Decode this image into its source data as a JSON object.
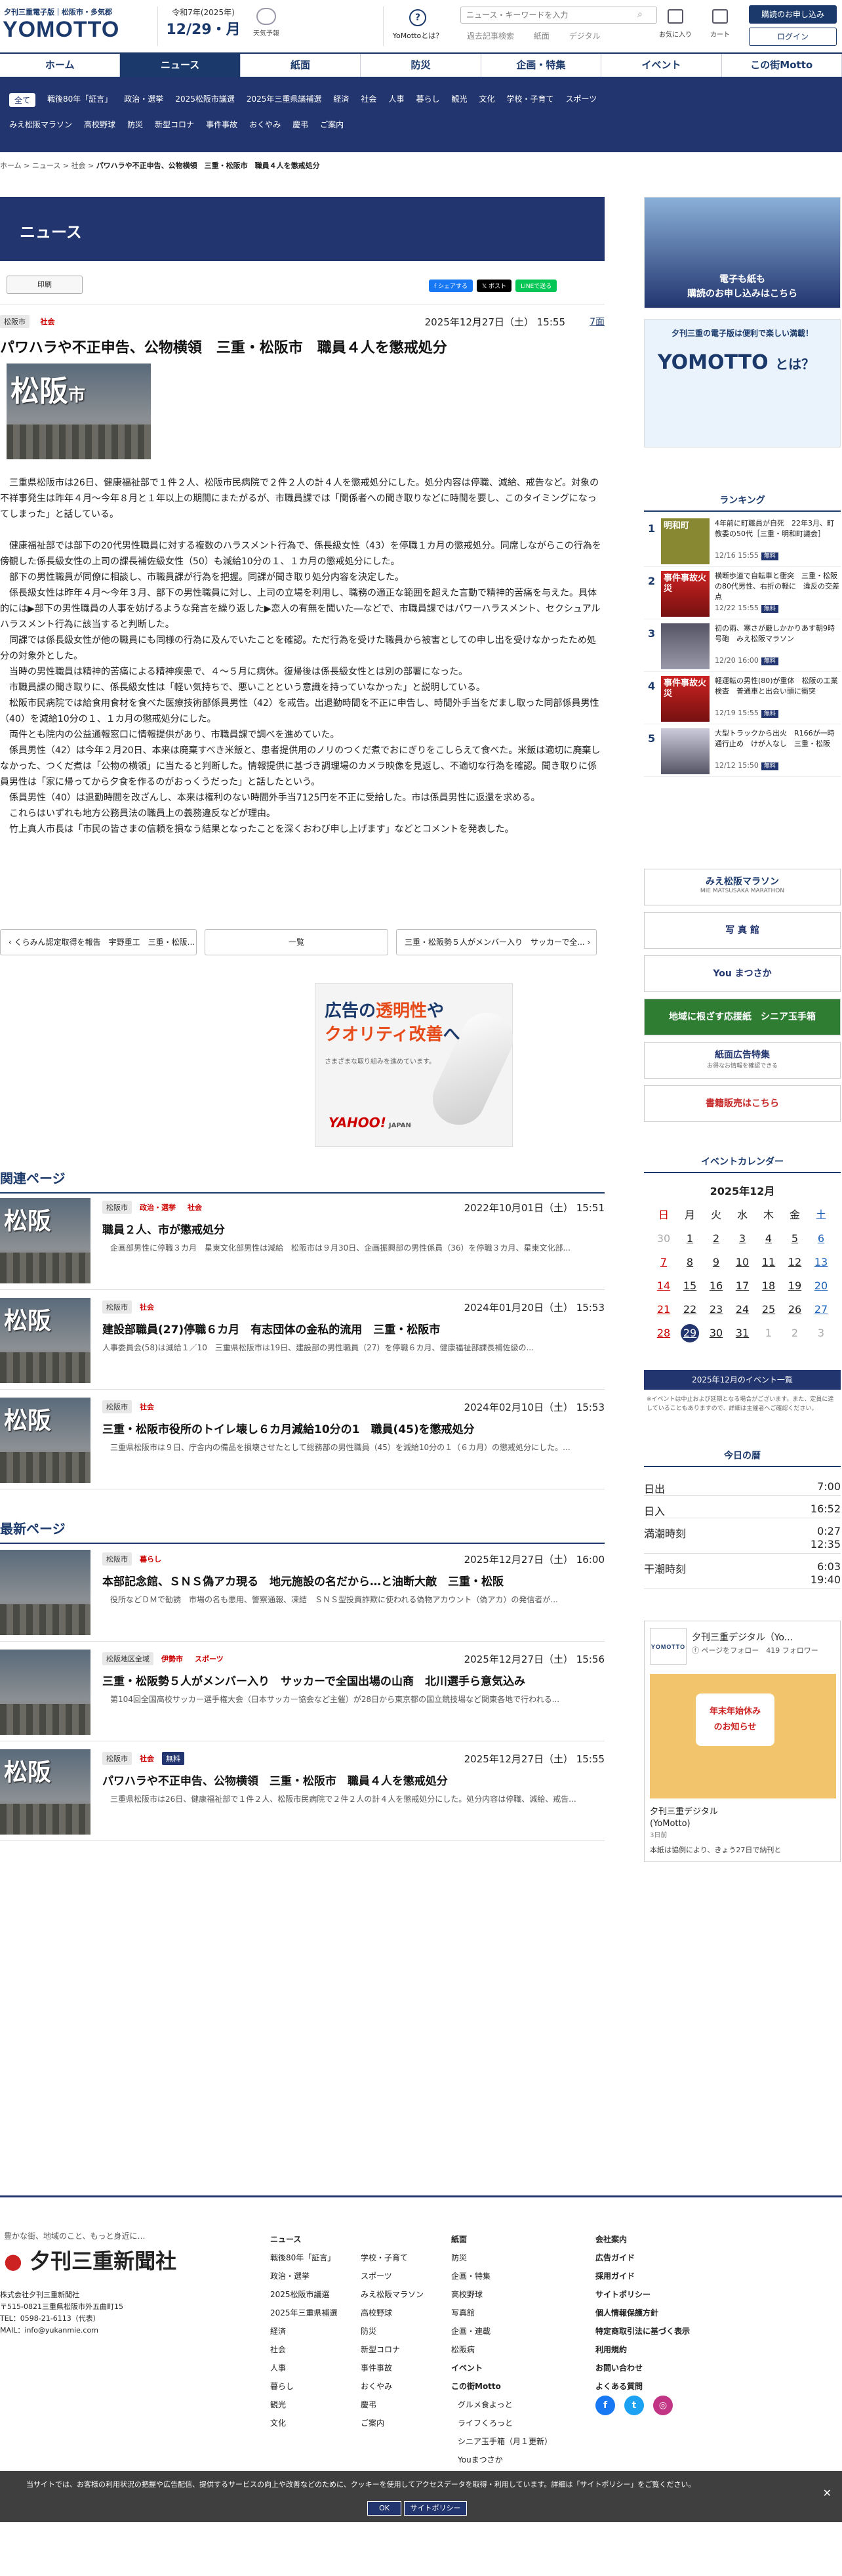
{
  "header": {
    "logo_sub": "夕刊三重電子版｜松阪市・多気郡",
    "logo_text": "YOMOTTO",
    "date_small": "令和7年(2025年)",
    "date_large": "12/29・月",
    "weather_label": "天気予報",
    "whats_label": "YoMottoとは？",
    "search_placeholder": "ニュース・キーワードを入力",
    "links": [
      "過去記事検索",
      "紙面",
      "デジタル"
    ],
    "icons": [
      {
        "label": "お気に入り",
        "icon": "star-icon"
      },
      {
        "label": "カート",
        "icon": "cart-icon"
      }
    ],
    "subscribe_label": "購読のお申し込み",
    "login_label": "ログイン"
  },
  "nav": [
    "ホーム",
    "ニュース",
    "紙面",
    "防災",
    "企画・特集",
    "イベント",
    "この街Motto"
  ],
  "nav_active": 1,
  "subnav": [
    [
      "全て",
      "戦後80年「証言」",
      "政治・選挙",
      "2025松阪市議選",
      "2025年三重県議補選",
      "経済",
      "社会",
      "人事",
      "暮らし",
      "観光",
      "文化",
      "学校・子育て",
      "スポーツ"
    ],
    [
      "みえ松阪マラソン",
      "高校野球",
      "防災",
      "新型コロナ",
      "事件事故",
      "おくやみ",
      "慶弔",
      "ご案内"
    ]
  ],
  "breadcrumb": [
    "ホーム",
    "ニュース",
    "社会",
    "パワハラや不正申告、公物横領　三重・松阪市　職員４人を懲戒処分"
  ],
  "section_title": "ニュース",
  "print_label": "印刷",
  "shares": [
    {
      "label": "f シェアする",
      "color": "#1877f2"
    },
    {
      "label": "𝕏 ポスト",
      "color": "#000000"
    },
    {
      "label": "LINEで送る",
      "color": "#06c755"
    }
  ],
  "article": {
    "tags": [
      "松阪市",
      "社会"
    ],
    "date": "2025年12月27日（土） 15:55",
    "page": "7面",
    "title": "パワハラや不正申告、公物横領　三重・松阪市　職員４人を懲戒処分",
    "thumb_label": "松阪",
    "thumb_label_small": "市",
    "paragraphs": [
      "　三重県松阪市は26日、健康福祉部で１件２人、松阪市民病院で２件２人の計４人を懲戒処分にした。処分内容は停職、減給、戒告など。対象の不祥事発生は昨年４月〜今年８月と１年以上の期間にまたがるが、市職員課では「関係者への聞き取りなどに時間を要し、このタイミングになってしまった」と話している。",
      "　健康福祉部では部下の20代男性職員に対する複数のハラスメント行為で、係長級女性（43）を停職１カ月の懲戒処分。同席しながらこの行為を傍観した係長級女性の上司の課長補佐級女性（50）も減給10分の１、１カ月の懲戒処分にした。",
      "　部下の男性職員が同僚に相談し、市職員課が行為を把握。同課が聞き取り処分内容を決定した。",
      "　係長級女性は昨年４月〜今年３月、部下の男性職員に対し、上司の立場を利用し、職務の適正な範囲を超えた言動で精神的苦痛を与えた。具体的には▶部下の男性職員の人事を妨げるような発言を繰り返した▶恋人の有無を聞いた―などで、市職員課ではパワーハラスメント、セクシュアルハラスメント行為に該当すると判断した。",
      "　同課では係長級女性が他の職員にも同様の行為に及んでいたことを確認。ただ行為を受けた職員から被害としての申し出を受けなかったため処分の対象外とした。",
      "　当時の男性職員は精神的苦痛による精神疾患で、４〜５月に病休。復帰後は係長級女性とは別の部署になった。",
      "　市職員課の聞き取りに、係長級女性は「軽い気持ちで、悪いことという意識を持っていなかった」と説明している。",
      "　松阪市民病院では給食用食材を食べた医療技術部係員男性（42）を戒告。出退勤時間を不正に申告し、時間外手当をだまし取った同部係員男性（40）を減給10分の１、１カ月の懲戒処分にした。",
      "　両件とも院内の公益通報窓口に情報提供があり、市職員課で調べを進めていた。",
      "　係員男性（42）は今年２月20日、本来は廃棄すべき米飯と、患者提供用のノリのつくだ煮でおにぎりをこしらえて食べた。米飯は適切に廃棄しなかった、つくだ煮は「公物の横領」に当たると判断した。情報提供に基づき調理場のカメラ映像を見返し、不適切な行為を確認。聞き取りに係員男性は「家に帰ってから夕食を作るのがおっくうだった」と話したという。",
      "　係員男性（40）は退勤時間を改ざんし、本来は権利のない時間外手当7125円を不正に受給した。市は係員男性に返還を求める。",
      "　これらはいずれも地方公務員法の職員上の義務違反などが理由。",
      "　竹上真人市長は「市民の皆さまの信頼を損なう結果となったことを深くおわび申し上げます」などとコメントを発表した。"
    ]
  },
  "pager": {
    "prev": "くらみん認定取得を報告　宇野重工　三重・松阪...",
    "list": "一覧",
    "next": "三重・松阪勢５人がメンバー入り　サッカーで全..."
  },
  "ad": {
    "line1": "広告の",
    "line1_hl": "透明性",
    "line1b": "や",
    "line2_hl": "クオリティ改善",
    "line2": "へ",
    "sub": "さまざまな取り組みを進めています。",
    "brand": "YAHOO!",
    "brand_sub": "JAPAN"
  },
  "related_heading": "関連ページ",
  "related": [
    {
      "tags": [
        "松阪市",
        "政治・選挙",
        "社会"
      ],
      "date": "2022年10月01日（土） 15:51",
      "title": "職員２人、市が懲戒処分",
      "desc": "　企画部男性に停職３カ月　星東文化部男性は減給　松阪市は９月30日、企画振興部の男性係員（36）を停職３カ月、星東文化部...",
      "thumb": "松阪"
    },
    {
      "tags": [
        "松阪市",
        "社会"
      ],
      "date": "2024年01月20日（土） 15:53",
      "title": "建設部職員(27)停職６カ月　有志団体の金私的流用　三重・松阪市",
      "desc": "人事委員会(58)は減給１／10　三重県松阪市は19日、建設部の男性職員（27）を停職６カ月、健康福祉部課長補佐級の...",
      "thumb": "松阪"
    },
    {
      "tags": [
        "松阪市",
        "社会"
      ],
      "date": "2024年02月10日（土） 15:53",
      "title": "三重・松阪市役所のトイレ壊し６カ月減給10分の1　職員(45)を懲戒処分",
      "desc": "　三重県松阪市は９日、庁舎内の備品を損壊させたとして総務部の男性職員（45）を減給10分の１（６カ月）の懲戒処分にした。...",
      "thumb": "松阪"
    }
  ],
  "latest_heading": "最新ページ",
  "latest": [
    {
      "tags": [
        "松阪市",
        "暮らし"
      ],
      "date": "2025年12月27日（土） 16:00",
      "title": "本部記念館、ＳＮＳ偽アカ現る　地元施設の名だから…と油断大敵　三重・松阪",
      "desc": "　役所などＤＭで勧誘　市場の名も悪用、警察通報、凍結　ＳＮＳ型投資詐欺に使われる偽物アカウント（偽アカ）の発信者が...",
      "thumb": ""
    },
    {
      "tags": [
        "松阪地区全域",
        "伊勢市",
        "スポーツ"
      ],
      "date": "2025年12月27日（土） 15:56",
      "title": "三重・松阪勢５人がメンバー入り　サッカーで全国出場の山商　北川選手ら意気込み",
      "desc": "　第104回全国高校サッカー選手権大会（日本サッカー協会など主催）が28日から東京都の国立競技場など関東各地で行われる...",
      "thumb": ""
    },
    {
      "tags": [
        "松阪市",
        "社会",
        "無料"
      ],
      "date": "2025年12月27日（土） 15:55",
      "title": "パワハラや不正申告、公物横領　三重・松阪市　職員４人を懲戒処分",
      "desc": "　三重県松阪市は26日、健康福祉部で１件２人、松阪市民病院で２件２人の計４人を懲戒処分にした。処分内容は停職、減給、戒告...",
      "thumb": "松阪"
    }
  ],
  "side": {
    "banner1": "電子も紙も\n購読のお申し込みはこちら",
    "banner2_head": "夕刊三重の電子版は便利で楽しい満載！",
    "banner2_logo": "YOMOTTO",
    "banner2_tail": "とは？",
    "ranking_heading": "ランキング",
    "ranking": [
      {
        "n": "1",
        "title": "4年前に町職員が自死　22年3月、町教委の50代［三重・明和町議会］",
        "date": "12/16 15:55",
        "badge": "無料",
        "thumb": "明和町"
      },
      {
        "n": "2",
        "title": "横断歩道で自転車と衝突　三重・松阪の80代男性、右折の軽に　違反の交差点",
        "date": "12/22 15:55",
        "badge": "無料",
        "thumb": "事件事故火災"
      },
      {
        "n": "3",
        "title": "初の雨、寒さが厳しかかりあす朝9時号砲　みえ松阪マラソン",
        "date": "12/20 16:00",
        "badge": "無料",
        "thumb": ""
      },
      {
        "n": "4",
        "title": "軽運転の男性(80)が重体　松阪の工業検査　普通車と出会い頭に衝突",
        "date": "12/19 15:55",
        "badge": "無料",
        "thumb": "事件事故火災"
      },
      {
        "n": "5",
        "title": "大型トラックから出火　R166が一時通行止め　けが人なし　三重・松阪",
        "date": "12/12 15:50",
        "badge": "無料",
        "thumb": ""
      }
    ],
    "banners": [
      {
        "label": "みえ松阪マラソン",
        "sub": "MIE MATSUSAKA MARATHON",
        "color": "#1b3a6b"
      },
      {
        "label": "写 真 館",
        "sub": "",
        "color": "#22356f"
      },
      {
        "label": "You まつさか",
        "sub": "",
        "color": "#22356f"
      },
      {
        "label": "地域に根ざす応援紙　シニア玉手箱",
        "sub": "",
        "color": "#2e7d32"
      },
      {
        "label": "紙面広告特集",
        "sub": "お得なお情報を確認できる",
        "color": "#22356f"
      },
      {
        "label": "書籍販売はこちら",
        "sub": "",
        "color": "#c62828"
      }
    ],
    "calendar_heading": "イベントカレンダー",
    "calendar_month": "2025年12月",
    "calendar_dow": [
      "日",
      "月",
      "火",
      "水",
      "木",
      "金",
      "土"
    ],
    "calendar_days": [
      "30",
      "1",
      "2",
      "3",
      "4",
      "5",
      "6",
      "7",
      "8",
      "9",
      "10",
      "11",
      "12",
      "13",
      "14",
      "15",
      "16",
      "17",
      "18",
      "19",
      "20",
      "21",
      "22",
      "23",
      "24",
      "25",
      "26",
      "27",
      "28",
      "29",
      "30",
      "31",
      "1",
      "2",
      "3"
    ],
    "calendar_today": "29",
    "calendar_btn": "2025年12月のイベント一覧",
    "calendar_note": "※イベントは中止および延期となる場合がございます。また、定員に達していることもありますので、詳細は主催者へご確認ください。",
    "today_heading": "今日の暦",
    "today_rows": [
      {
        "k": "日出",
        "v": "7:00"
      },
      {
        "k": "日入",
        "v": "16:52"
      },
      {
        "k": "満潮時刻",
        "v": "0:27\n12:35"
      },
      {
        "k": "干潮時刻",
        "v": "6:03\n19:40"
      }
    ],
    "fb": {
      "page_name": "夕刊三重デジタル（Yo...",
      "followers": "419 フォロワー",
      "follow_label": "ページをフォロー",
      "logo": "YOMOTTO",
      "card": "年末年始休み\nのお知らせ",
      "name": "夕刊三重デジタル\n(YoMotto)",
      "name_sub": "3日前",
      "footer": "本紙は協例により、きょう27日で納刊と"
    }
  },
  "footer": {
    "tagline": "豊かな街、地域のこと、もっと身近に…",
    "logo": "夕刊三重新聞社",
    "address": [
      "株式会社夕刊三重新聞社",
      "〒515-0821三重県松阪市外五曲町15",
      "TEL：0598-21-6113（代表）",
      "MAIL：info@yukanmie.com"
    ],
    "col1_head": "ニュース",
    "col1": [
      "戦後80年「証言」",
      "政治・選挙",
      "2025松阪市議選",
      "2025年三重県補選",
      "経済",
      "社会",
      "人事",
      "暮らし",
      "観光",
      "文化"
    ],
    "col2": [
      "学校・子育て",
      "スポーツ",
      "みえ松阪マラソン",
      "高校野球",
      "防災",
      "新型コロナ",
      "事件事故",
      "おくやみ",
      "慶弔",
      "ご案内"
    ],
    "col3_head": "紙面",
    "col3": [
      "防災",
      "企画・特集",
      "高校野球",
      "写真館",
      "企画・連載",
      "松阪病"
    ],
    "col3_head2": "イベント",
    "col3_head3": "この街Motto",
    "col3b": [
      "グルメ食よっと",
      "ライフくろっと",
      "シニア玉手箱（月１更新）",
      "Youまつさか"
    ],
    "col4": [
      "会社案内",
      "広告ガイド",
      "採用ガイド",
      "サイトポリシー",
      "個人情報保護方針",
      "特定商取引法に基づく表示",
      "利用規約",
      "お問い合わせ",
      "よくある質問"
    ]
  },
  "cookie": {
    "text": "当サイトでは、お客様の利用状況の把握や広告配信、提供するサービスの向上や改善などのために、クッキーを使用してアクセスデータを取得・利用しています。詳細は「サイトポリシー」をご覧ください。",
    "ok": "OK",
    "policy": "サイトポリシー"
  }
}
